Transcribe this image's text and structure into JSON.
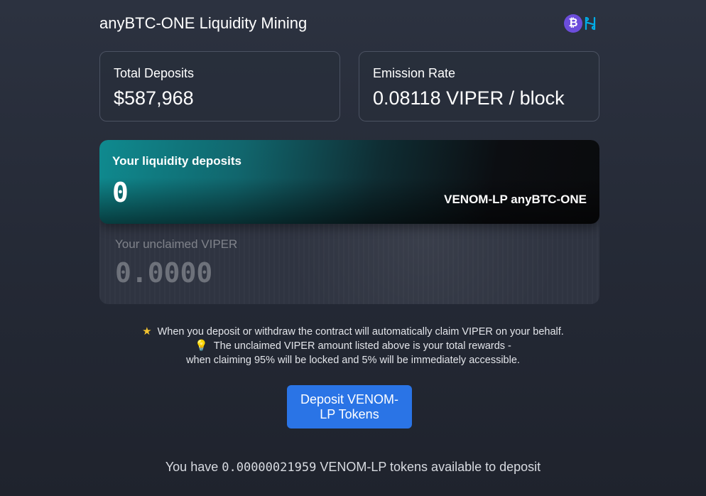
{
  "header": {
    "title": "anyBTC-ONE Liquidity Mining",
    "icons": [
      "bitcoin-icon",
      "harmony-one-icon"
    ],
    "btc_symbol": "₿"
  },
  "stats": {
    "total_deposits": {
      "label": "Total Deposits",
      "value": "$587,968"
    },
    "emission_rate": {
      "label": "Emission Rate",
      "value": "0.08118 VIPER / block"
    }
  },
  "liquidity": {
    "deposits_label": "Your liquidity deposits",
    "deposits_value": "0",
    "pair": "VENOM-LP anyBTC-ONE",
    "unclaimed_label": "Your unclaimed VIPER",
    "unclaimed_value": "0.0000"
  },
  "info": {
    "line1": "When you deposit or withdraw the contract will automatically claim VIPER on your behalf.",
    "line2": "The unclaimed VIPER amount listed above is your total rewards -",
    "line3": "when claiming 95% will be locked and 5% will be immediately accessible.",
    "star_glyph": "★",
    "bulb_glyph": "💡"
  },
  "deposit_button": {
    "label": "Deposit VENOM-LP Tokens"
  },
  "available": {
    "prefix": "You have",
    "amount": "0.00000021959",
    "suffix": "VENOM-LP tokens available to deposit"
  },
  "colors": {
    "background": "#242935",
    "button": "#2a74e6",
    "teal_accent": "#0f8a8f",
    "btc_icon": "#6c4ddb",
    "one_icon": "#00aee9"
  }
}
